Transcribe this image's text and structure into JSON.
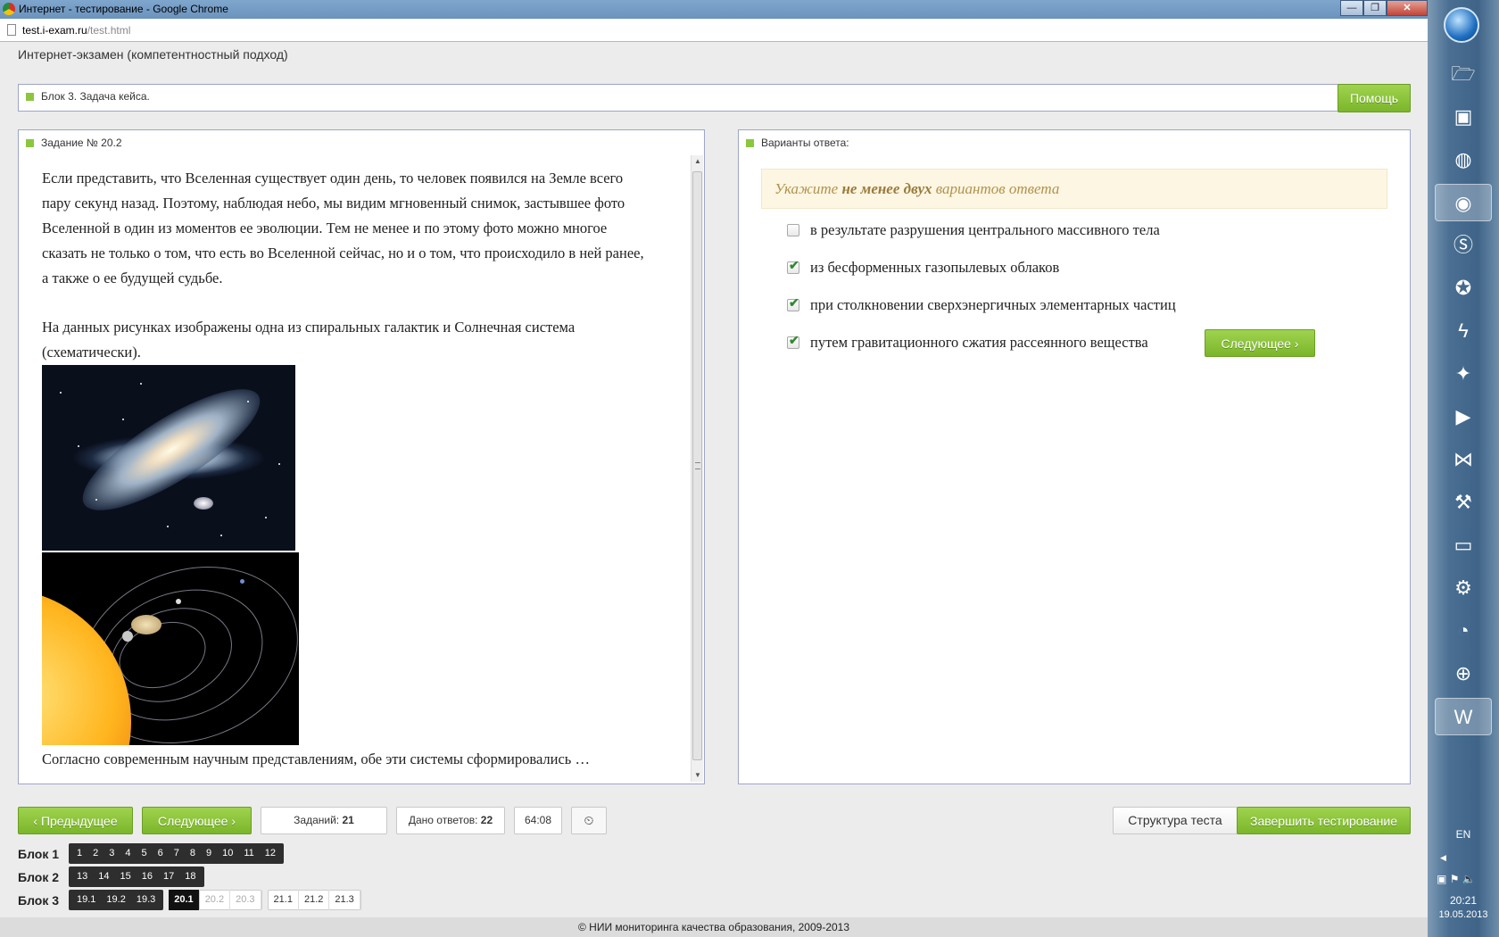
{
  "window": {
    "title": "Интернет - тестирование - Google Chrome",
    "url_host": "test.i-exam.ru",
    "url_path": "/test.html"
  },
  "header": {
    "title": "Интернет-экзамен (компетентностный подход)"
  },
  "block_bar": {
    "label": "Блок 3. Задача кейса.",
    "help_label": "Помощь"
  },
  "task": {
    "heading": "Задание № 20.2",
    "paragraph1": "Если представить, что Вселенная существует один день, то человек появился на Земле всего пару секунд назад. Поэтому, наблюдая небо, мы видим мгновенный снимок, застывшее фото Вселенной в один из моментов ее эволюции. Тем не менее и по этому фото можно многое сказать не только о том, что есть во Вселенной сейчас, но и о том, что происходило в ней ранее, а также о ее будущей судьбе.",
    "paragraph2": "На данных рисунках изображены одна из спиральных галактик и Солнечная система (схематически).",
    "question": "Согласно современным научным представлениям, обе эти системы сформировались …"
  },
  "answers": {
    "heading": "Варианты ответа:",
    "instruction_pre": "Укажите ",
    "instruction_bold": "не менее двух",
    "instruction_post": " вариантов ответа",
    "options": [
      {
        "text": "в результате разрушения центрального массивного тела",
        "checked": false
      },
      {
        "text": "из бесформенных газопылевых облаков",
        "checked": true
      },
      {
        "text": "при столкновении сверхэнергичных элементарных частиц",
        "checked": true
      },
      {
        "text": "путем гравитационного сжатия рассеянного вещества",
        "checked": true
      }
    ],
    "next_label": "Следующее"
  },
  "nav": {
    "prev_label": "Предыдущее",
    "next_label": "Следующее",
    "tasks_label": "Заданий: ",
    "tasks_value": "21",
    "answers_label": "Дано ответов: ",
    "answers_value": "22",
    "timer": "64:08",
    "structure_label": "Структура теста",
    "finish_label": "Завершить тестирование"
  },
  "blocks": {
    "b1_label": "Блок 1",
    "b1": [
      "1",
      "2",
      "3",
      "4",
      "5",
      "6",
      "7",
      "8",
      "9",
      "10",
      "11",
      "12"
    ],
    "b2_label": "Блок 2",
    "b2": [
      "13",
      "14",
      "15",
      "16",
      "17",
      "18"
    ],
    "b3_label": "Блок 3",
    "b3_a": [
      "19.1",
      "19.2",
      "19.3"
    ],
    "b3_current": "20.1",
    "b3_b": [
      "20.2",
      "20.3"
    ],
    "b3_c": [
      "21.1",
      "21.2",
      "21.3"
    ]
  },
  "footer": "© НИИ мониторинга качества образования, 2009-2013",
  "taskbar": {
    "lang": "EN",
    "time": "20:21",
    "date": "19.05.2013"
  }
}
